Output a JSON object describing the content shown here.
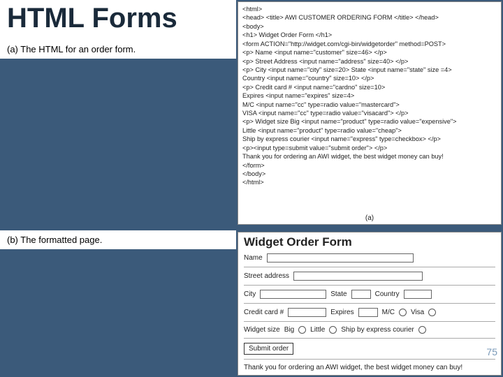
{
  "slide": {
    "title": "HTML Forms",
    "caption_a": "(a) The HTML for an order form.",
    "caption_b": "(b) The formatted page.",
    "page_number": "75"
  },
  "code": {
    "lines": [
      "<html>",
      "<head> <title> AWI CUSTOMER ORDERING FORM </title> </head>",
      "<body>",
      "<h1> Widget Order Form </h1>",
      "<form ACTION=\"http://widget.com/cgi-bin/widgetorder\" method=POST>",
      "<p> Name <input name=\"customer\" size=46> </p>",
      "<p> Street Address <input name=\"address\" size=40> </p>",
      "<p> City <input name=\"city\" size=20> State <input name=\"state\" size =4>",
      "Country <input name=\"country\" size=10> </p>",
      "<p> Credit card # <input name=\"cardno\" size=10>",
      "Expires <input name=\"expires\" size=4>",
      "M/C <input name=\"cc\" type=radio value=\"mastercard\">",
      "VISA <input name=\"cc\" type=radio value=\"visacard\"> </p>",
      "<p> Widget size Big <input name=\"product\" type=radio value=\"expensive\">",
      "Little <input name=\"product\" type=radio value=\"cheap\">",
      "Ship by express courier <input name=\"express\" type=checkbox> </p>",
      "<p><input type=submit value=\"submit order\"> </p>",
      "Thank you for ordering an AWI widget, the best widget money can buy!",
      "</form>",
      "</body>",
      "</html>"
    ],
    "fig_label": "(a)"
  },
  "rendered": {
    "heading": "Widget Order Form",
    "labels": {
      "name": "Name",
      "street": "Street address",
      "city": "City",
      "state": "State",
      "country": "Country",
      "cc": "Credit card #",
      "expires": "Expires",
      "mc": "M/C",
      "visa": "Visa",
      "widget_size": "Widget size",
      "big": "Big",
      "little": "Little",
      "ship": "Ship by express courier",
      "submit": "Submit order",
      "thanks": "Thank you for ordering an AWI widget, the best widget money can buy!"
    }
  }
}
